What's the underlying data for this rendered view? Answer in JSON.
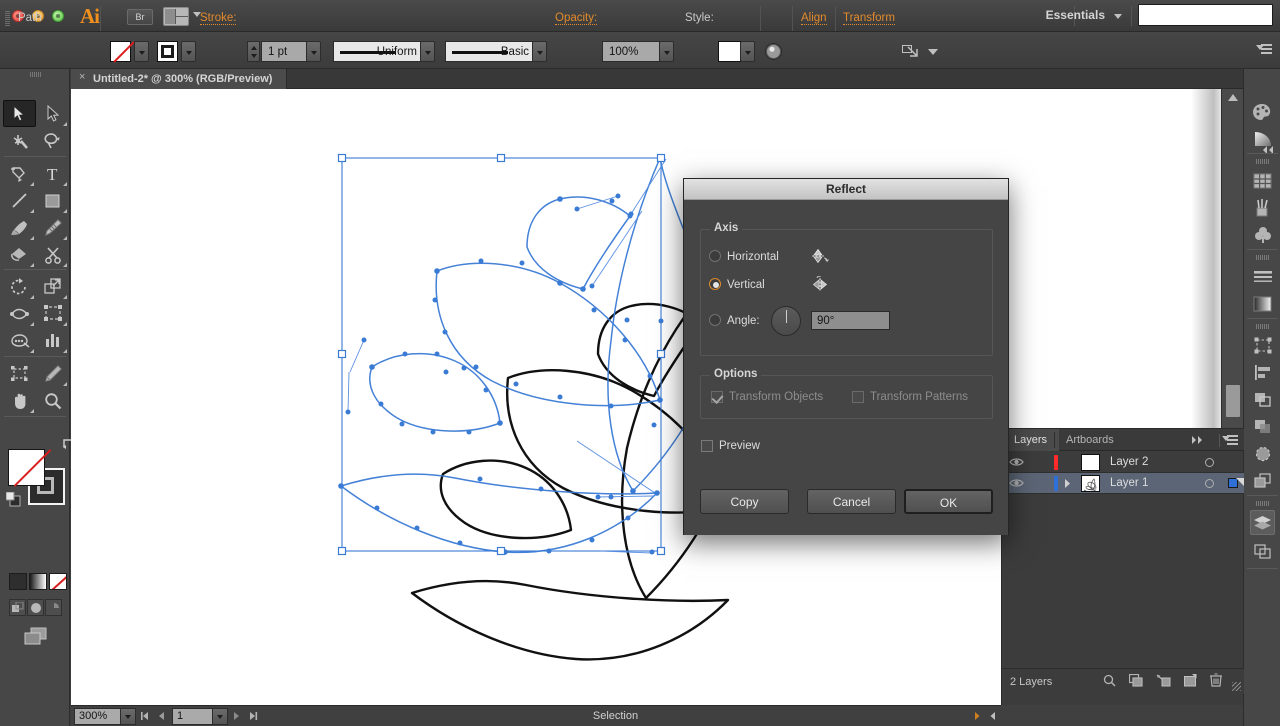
{
  "app": {
    "name": "Adobe Illustrator",
    "logo_text": "Ai",
    "bridge_button": "Br",
    "workspace": "Essentials"
  },
  "control_bar": {
    "object_type": "Path",
    "fill_label": "fill-none",
    "stroke_swatch_label": "stroke-black",
    "stroke_label": "Stroke:",
    "stroke_weight": "1 pt",
    "profile": "Uniform",
    "brush": "Basic",
    "opacity_label": "Opacity:",
    "opacity_value": "100%",
    "style_label": "Style:",
    "align_label": "Align",
    "transform_label": "Transform",
    "search_value": ""
  },
  "document": {
    "tab_title": "Untitled-2* @ 300% (RGB/Preview)",
    "close_glyph": "×"
  },
  "dialog": {
    "title": "Reflect",
    "axis_group": "Axis",
    "axis_options": [
      {
        "label": "Horizontal",
        "selected": false
      },
      {
        "label": "Vertical",
        "selected": true
      },
      {
        "label": "Angle:",
        "selected": false
      }
    ],
    "angle_value": "90°",
    "options_group": "Options",
    "transform_objects": {
      "label": "Transform Objects",
      "checked": true,
      "enabled": false
    },
    "transform_patterns": {
      "label": "Transform Patterns",
      "checked": false,
      "enabled": false
    },
    "preview": {
      "label": "Preview",
      "checked": false
    },
    "buttons": {
      "copy": "Copy",
      "cancel": "Cancel",
      "ok": "OK"
    }
  },
  "layers_panel": {
    "tabs": [
      {
        "label": "Layers",
        "active": true
      },
      {
        "label": "Artboards",
        "active": false
      }
    ],
    "rows": [
      {
        "name": "Layer 2",
        "color": "#ff2a2a",
        "selected": false,
        "expandable": false,
        "targeted": false
      },
      {
        "name": "Layer 1",
        "color": "#2f6fd8",
        "selected": true,
        "expandable": true,
        "targeted": true
      }
    ],
    "footer_count": "2 Layers"
  },
  "status_bar": {
    "zoom": "300%",
    "page": "1",
    "tool": "Selection"
  },
  "tools": {
    "left": [
      "selection-tool",
      "direct-selection-tool",
      "magic-wand-tool",
      "lasso-tool",
      "pen-tool",
      "type-tool",
      "line-segment-tool",
      "rectangle-tool",
      "paintbrush-tool",
      "blob-brush-tool",
      "shape-builder-tool",
      "scissors-tool",
      "rotate-tool",
      "scale-tool",
      "width-tool",
      "free-transform-tool",
      "symbol-sprayer-tool",
      "column-graph-tool",
      "artboard-tool",
      "slice-tool",
      "hand-tool",
      "zoom-tool"
    ],
    "selected": "selection-tool",
    "fill_color": "#ffffff",
    "fill_is_none": true,
    "stroke_color": "#2b2b2b"
  },
  "dock": {
    "items": [
      "color-panel",
      "color-guide-panel",
      "swatches-panel",
      "brushes-panel",
      "symbols-panel",
      "stroke-panel",
      "gradient-panel",
      "transform-panel",
      "align-panel",
      "pathfinder-panel",
      "transparency-panel",
      "appearance-panel",
      "graphic-styles-panel",
      "layers-panel",
      "artboards-panel"
    ],
    "active": "layers-panel"
  },
  "canvas": {
    "background": "#ffffff",
    "selection_color": "#2f6fd8",
    "artwork_name": "curved-petal-vector-shape"
  }
}
